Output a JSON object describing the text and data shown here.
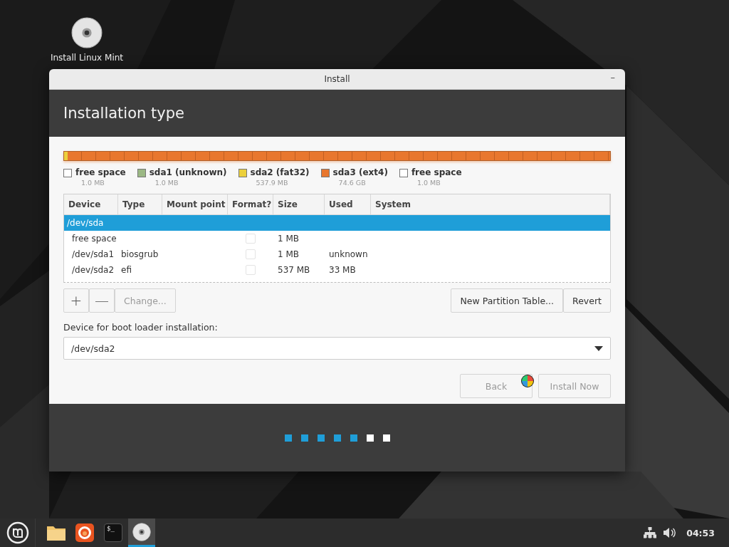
{
  "desktop": {
    "icons": [
      {
        "label": "Install Linux Mint"
      }
    ]
  },
  "window": {
    "title": "Install",
    "minimize": "–",
    "heading": "Installation type"
  },
  "partition_map": {
    "legend": [
      {
        "name": "free space",
        "size": "1.0 MB",
        "color": "#ffffff"
      },
      {
        "name": "sda1 (unknown)",
        "size": "1.0 MB",
        "color": "#9bb884"
      },
      {
        "name": "sda2 (fat32)",
        "size": "537.9 MB",
        "color": "#ecd03c",
        "level": 0.007
      },
      {
        "name": "sda3 (ext4)",
        "size": "74.6 GB",
        "color": "#e8772e",
        "level": 0.993
      },
      {
        "name": "free space",
        "size": "1.0 MB",
        "color": "#ffffff"
      }
    ]
  },
  "table": {
    "columns": [
      "Device",
      "Type",
      "Mount point",
      "Format?",
      "Size",
      "Used",
      "System"
    ],
    "rows": [
      {
        "device": "/dev/sda",
        "selected": true
      },
      {
        "device": "free space",
        "format": false,
        "size": "1 MB",
        "selected": false
      },
      {
        "device": "/dev/sda1",
        "type": "biosgrub",
        "format": false,
        "size": "1 MB",
        "used": "unknown",
        "selected": false
      },
      {
        "device": "/dev/sda2",
        "type": "efi",
        "format": false,
        "size": "537 MB",
        "used": "33 MB",
        "selected": false
      }
    ]
  },
  "toolbar": {
    "add": "+",
    "remove": "—",
    "change": {
      "label": "Change...",
      "disabled": true
    },
    "new_table": {
      "label": "New Partition Table...",
      "disabled": false
    },
    "revert": {
      "label": "Revert",
      "disabled": false
    }
  },
  "boot_loader": {
    "label": "Device for boot loader installation:",
    "value": "/dev/sda2"
  },
  "buttons": [
    {
      "label": "Back",
      "disabled": true
    },
    {
      "label": "Install Now",
      "disabled": true
    }
  ],
  "steps": [
    {
      "completed": true
    },
    {
      "completed": true
    },
    {
      "completed": true
    },
    {
      "completed": true
    },
    {
      "completed": true
    },
    {
      "completed": false
    },
    {
      "completed": false
    }
  ],
  "taskbar": {
    "apps": [
      {
        "kind": "files",
        "active": false
      },
      {
        "kind": "browser",
        "active": false
      },
      {
        "kind": "terminal",
        "text": "$_",
        "active": false
      },
      {
        "kind": "disc",
        "active": true
      }
    ],
    "clock": "04:53"
  }
}
